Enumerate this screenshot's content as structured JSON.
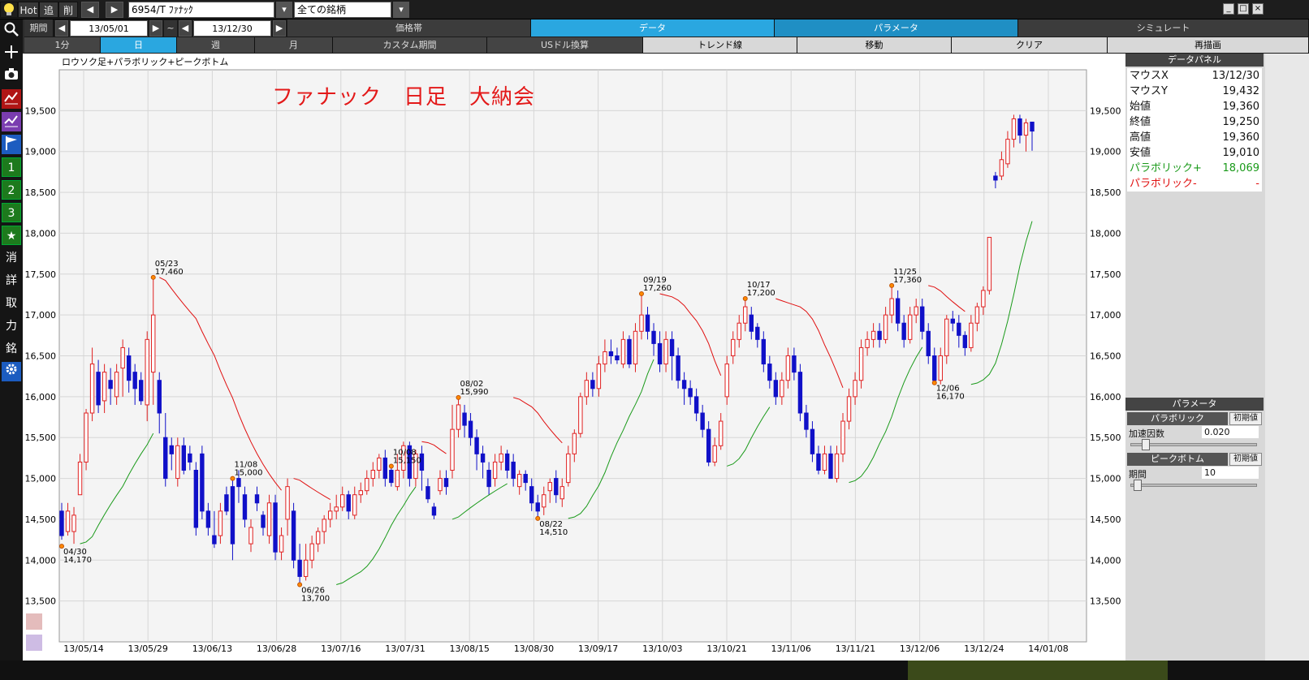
{
  "toolbar": {
    "hot": "Hot",
    "add": "追",
    "del": "削",
    "symbol": "6954/T ﾌｧﾅｯｸ",
    "universe": "全ての銘柄"
  },
  "period": {
    "label": "期間",
    "from": "13/05/01",
    "tilde": "~",
    "to": "13/12/30"
  },
  "menu_tabs": [
    "価格帯",
    "データ",
    "パラメータ",
    "シミュレート"
  ],
  "timeframe_tabs": [
    "1分",
    "日",
    "週",
    "月",
    "カスタム期間",
    "USドル換算",
    "トレンド線",
    "移動",
    "クリア",
    "再描画"
  ],
  "sidebar": [
    "消",
    "詳",
    "取",
    "力",
    "銘"
  ],
  "sidebar_numbers": [
    "1",
    "2",
    "3"
  ],
  "chart": {
    "subtitle": "ロウソク足+パラボリック+ピークボトム",
    "title": "ファナック　日足　大納会"
  },
  "data_panel": {
    "header": "データパネル",
    "rows": [
      {
        "k": "マウスX",
        "v": "13/12/30"
      },
      {
        "k": "マウスY",
        "v": "19,432"
      },
      {
        "k": "始値",
        "v": "19,360"
      },
      {
        "k": "終値",
        "v": "19,250"
      },
      {
        "k": "高値",
        "v": "19,360"
      },
      {
        "k": "安値",
        "v": "19,010"
      },
      {
        "k": "パラボリック+",
        "v": "18,069"
      },
      {
        "k": "パラボリック-",
        "v": "-"
      }
    ]
  },
  "param_panel": {
    "header": "パラメータ",
    "parabolic": "パラボリック",
    "accel_label": "加速因数",
    "accel_value": "0.020",
    "peakbottom": "ピークボトム",
    "period_label": "期間",
    "period_value": "10",
    "init": "初期値"
  },
  "chart_data": {
    "type": "candlestick",
    "ylim": [
      13000,
      20000
    ],
    "y_ticks": [
      "13,500",
      "14,000",
      "14,500",
      "15,000",
      "15,500",
      "16,000",
      "16,500",
      "17,000",
      "17,500",
      "18,000",
      "18,500",
      "19,000",
      "19,500"
    ],
    "x_ticks": [
      "13/05/14",
      "13/05/29",
      "13/06/13",
      "13/06/28",
      "13/07/16",
      "13/07/31",
      "13/08/15",
      "13/08/30",
      "13/09/17",
      "13/10/03",
      "13/10/21",
      "13/11/06",
      "13/11/21",
      "13/12/06",
      "13/12/24",
      "14/01/08"
    ],
    "peak_bottom_labels": [
      {
        "date": "04/30",
        "value": "14,170"
      },
      {
        "date": "05/23",
        "value": "17,460"
      },
      {
        "date": "06/26",
        "value": "13,700"
      },
      {
        "date": "08/02",
        "value": "15,990"
      },
      {
        "date": "08/22",
        "value": "14,510"
      },
      {
        "date": "09/19",
        "value": "17,260"
      },
      {
        "date": "10/08",
        "value": "15,150"
      },
      {
        "date": "10/17",
        "value": "17,200"
      },
      {
        "date": "11/08",
        "value": "15,000"
      },
      {
        "date": "11/25",
        "value": "17,360"
      },
      {
        "date": "12/06",
        "value": "16,170"
      }
    ],
    "candles": [
      [
        14600,
        14300,
        14700,
        14250
      ],
      [
        14350,
        14600,
        14700,
        14300
      ],
      [
        14350,
        14550,
        14650,
        14200
      ],
      [
        14800,
        15200,
        15300,
        14800
      ],
      [
        15200,
        15800,
        15850,
        15100
      ],
      [
        15800,
        16400,
        16600,
        15700
      ],
      [
        16300,
        15900,
        16450,
        15800
      ],
      [
        15950,
        16300,
        16400,
        15800
      ],
      [
        16200,
        16100,
        16350,
        15900
      ],
      [
        16000,
        16300,
        16400,
        15900
      ],
      [
        16350,
        16600,
        16700,
        16000
      ],
      [
        16500,
        16200,
        16600,
        16050
      ],
      [
        16300,
        16100,
        16400,
        15900
      ],
      [
        16200,
        15950,
        16300,
        15900
      ],
      [
        15900,
        16700,
        16800,
        15700
      ],
      [
        16300,
        17000,
        17460,
        15900
      ],
      [
        16200,
        15800,
        16300,
        15550
      ],
      [
        15500,
        15000,
        15800,
        14900
      ],
      [
        15400,
        15300,
        15500,
        15100
      ],
      [
        15000,
        15400,
        15500,
        14900
      ],
      [
        15400,
        15100,
        15500,
        15050
      ],
      [
        15300,
        15200,
        15400,
        15100
      ],
      [
        15100,
        14400,
        15200,
        14300
      ],
      [
        15300,
        14600,
        15400,
        14500
      ],
      [
        14600,
        14400,
        14700,
        14300
      ],
      [
        14300,
        14200,
        14600,
        14150
      ],
      [
        14300,
        14600,
        14700,
        14200
      ],
      [
        14800,
        14600,
        14900,
        14550
      ],
      [
        14900,
        14200,
        15000,
        14000
      ],
      [
        15000,
        14900,
        15100,
        14700
      ],
      [
        14800,
        14500,
        14900,
        14400
      ],
      [
        14200,
        14400,
        14500,
        14100
      ],
      [
        14800,
        14700,
        14900,
        14600
      ],
      [
        14550,
        14400,
        14600,
        14300
      ],
      [
        14300,
        14700,
        14800,
        14200
      ],
      [
        14700,
        14100,
        14800,
        14000
      ],
      [
        14100,
        14300,
        14400,
        14000
      ],
      [
        14500,
        14900,
        15000,
        14300
      ],
      [
        14600,
        14000,
        14700,
        13900
      ],
      [
        14000,
        13800,
        14200,
        13700
      ],
      [
        13800,
        14000,
        14200,
        13750
      ],
      [
        14000,
        14200,
        14300,
        13900
      ],
      [
        14200,
        14350,
        14400,
        14100
      ],
      [
        14350,
        14500,
        14550,
        14200
      ],
      [
        14500,
        14600,
        14700,
        14400
      ],
      [
        14600,
        14650,
        14800,
        14500
      ],
      [
        14650,
        14800,
        14900,
        14600
      ],
      [
        14800,
        14600,
        14850,
        14500
      ],
      [
        14550,
        14800,
        14900,
        14500
      ],
      [
        14800,
        14850,
        14950,
        14700
      ],
      [
        14850,
        15000,
        15100,
        14800
      ],
      [
        15000,
        15100,
        15200,
        14900
      ],
      [
        15100,
        15250,
        15300,
        15000
      ],
      [
        15250,
        15000,
        15350,
        14900
      ],
      [
        15100,
        14950,
        15150,
        14900
      ],
      [
        14900,
        15100,
        15300,
        14850
      ],
      [
        15100,
        15400,
        15450,
        15000
      ],
      [
        15400,
        15000,
        15450,
        14900
      ],
      [
        15000,
        15300,
        15350,
        14900
      ],
      [
        15300,
        15100,
        15400,
        14850
      ],
      [
        14900,
        14750,
        15000,
        14700
      ],
      [
        14650,
        14550,
        14700,
        14500
      ],
      [
        14850,
        15000,
        15100,
        14800
      ],
      [
        15000,
        14900,
        15100,
        14800
      ],
      [
        15100,
        15600,
        15900,
        15000
      ],
      [
        15600,
        15900,
        15990,
        15500
      ],
      [
        15800,
        15650,
        15900,
        15500
      ],
      [
        15700,
        15500,
        15800,
        15400
      ],
      [
        15500,
        15300,
        15600,
        15100
      ],
      [
        15300,
        15200,
        15400,
        15000
      ],
      [
        15100,
        14900,
        15200,
        14800
      ],
      [
        15000,
        15200,
        15300,
        14900
      ],
      [
        15200,
        15300,
        15400,
        15100
      ],
      [
        15300,
        15100,
        15350,
        15000
      ],
      [
        15200,
        15000,
        15300,
        14900
      ],
      [
        14900,
        15050,
        15100,
        14800
      ],
      [
        15050,
        14950,
        15100,
        14850
      ],
      [
        14900,
        14700,
        15000,
        14600
      ],
      [
        14700,
        14600,
        14800,
        14510
      ],
      [
        14650,
        14800,
        14900,
        14550
      ],
      [
        14850,
        14950,
        15000,
        14700
      ],
      [
        15000,
        14800,
        15100,
        14700
      ],
      [
        14750,
        14900,
        15000,
        14650
      ],
      [
        14950,
        15300,
        15400,
        14900
      ],
      [
        15300,
        15550,
        15600,
        15200
      ],
      [
        15550,
        16000,
        16050,
        15500
      ],
      [
        16000,
        16200,
        16300,
        15900
      ],
      [
        16200,
        16100,
        16300,
        16000
      ],
      [
        16100,
        16400,
        16500,
        16000
      ],
      [
        16400,
        16550,
        16700,
        16300
      ],
      [
        16550,
        16500,
        16700,
        16400
      ],
      [
        16500,
        16450,
        16600,
        16400
      ],
      [
        16400,
        16700,
        16800,
        16350
      ],
      [
        16700,
        16400,
        16750,
        16350
      ],
      [
        16400,
        16800,
        16900,
        16300
      ],
      [
        16800,
        17000,
        17260,
        16700
      ],
      [
        17000,
        16800,
        17100,
        16700
      ],
      [
        16800,
        16650,
        16900,
        16500
      ],
      [
        16650,
        16400,
        16800,
        16300
      ],
      [
        16400,
        16700,
        16800,
        16300
      ],
      [
        16700,
        16500,
        16800,
        16200
      ],
      [
        16500,
        16200,
        16600,
        16100
      ],
      [
        16200,
        16100,
        16300,
        15900
      ],
      [
        16100,
        16000,
        16200,
        15900
      ],
      [
        16000,
        15800,
        16100,
        15700
      ],
      [
        15800,
        15600,
        15900,
        15500
      ],
      [
        15600,
        15200,
        15700,
        15150
      ],
      [
        15200,
        15400,
        15500,
        15150
      ],
      [
        15400,
        15700,
        15800,
        15350
      ],
      [
        16000,
        16400,
        16500,
        15900
      ],
      [
        16500,
        16700,
        16800,
        16400
      ],
      [
        16700,
        16900,
        17000,
        16600
      ],
      [
        16900,
        17100,
        17200,
        16800
      ],
      [
        17000,
        16800,
        17100,
        16700
      ],
      [
        16850,
        16700,
        16900,
        16600
      ],
      [
        16700,
        16400,
        16800,
        16300
      ],
      [
        16400,
        16200,
        16500,
        16100
      ],
      [
        16200,
        16000,
        16300,
        15900
      ],
      [
        16000,
        16200,
        16300,
        15900
      ],
      [
        16200,
        16500,
        16600,
        16100
      ],
      [
        16500,
        16300,
        16600,
        16200
      ],
      [
        16300,
        15800,
        16400,
        15700
      ],
      [
        15800,
        15600,
        15900,
        15500
      ],
      [
        15600,
        15300,
        15700,
        15200
      ],
      [
        15300,
        15100,
        15400,
        15050
      ],
      [
        15100,
        15300,
        15400,
        15050
      ],
      [
        15300,
        15000,
        15400,
        15000
      ],
      [
        15000,
        15300,
        15400,
        14950
      ],
      [
        15300,
        15700,
        15800,
        15200
      ],
      [
        15700,
        16000,
        16100,
        15600
      ],
      [
        16000,
        16200,
        16300,
        15900
      ],
      [
        16200,
        16600,
        16700,
        16100
      ],
      [
        16600,
        16700,
        16800,
        16500
      ],
      [
        16700,
        16800,
        16900,
        16600
      ],
      [
        16800,
        16700,
        16900,
        16600
      ],
      [
        16700,
        17000,
        17100,
        16650
      ],
      [
        17000,
        17200,
        17360,
        16900
      ],
      [
        17200,
        16900,
        17300,
        16800
      ],
      [
        16900,
        16700,
        17000,
        16600
      ],
      [
        16700,
        17000,
        17100,
        16650
      ],
      [
        17000,
        17100,
        17200,
        16900
      ],
      [
        17100,
        16800,
        17200,
        16700
      ],
      [
        16800,
        16500,
        16900,
        16400
      ],
      [
        16500,
        16200,
        16600,
        16170
      ],
      [
        16200,
        16500,
        16600,
        16150
      ],
      [
        16500,
        16950,
        17000,
        16400
      ],
      [
        16950,
        16900,
        17050,
        16800
      ],
      [
        16900,
        16750,
        17000,
        16600
      ],
      [
        16750,
        16600,
        16800,
        16500
      ],
      [
        16600,
        16900,
        17000,
        16550
      ],
      [
        16900,
        17100,
        17150,
        16800
      ],
      [
        17100,
        17300,
        17350,
        17000
      ],
      [
        17300,
        17950,
        17950,
        17250
      ],
      [
        18700,
        18650,
        18750,
        18550
      ],
      [
        18700,
        18900,
        19000,
        18650
      ],
      [
        18850,
        19150,
        19250,
        18800
      ],
      [
        19150,
        19400,
        19450,
        19050
      ],
      [
        19400,
        19200,
        19450,
        19100
      ],
      [
        19200,
        19350,
        19400,
        19000
      ],
      [
        19360,
        19250,
        19360,
        19010
      ]
    ]
  }
}
